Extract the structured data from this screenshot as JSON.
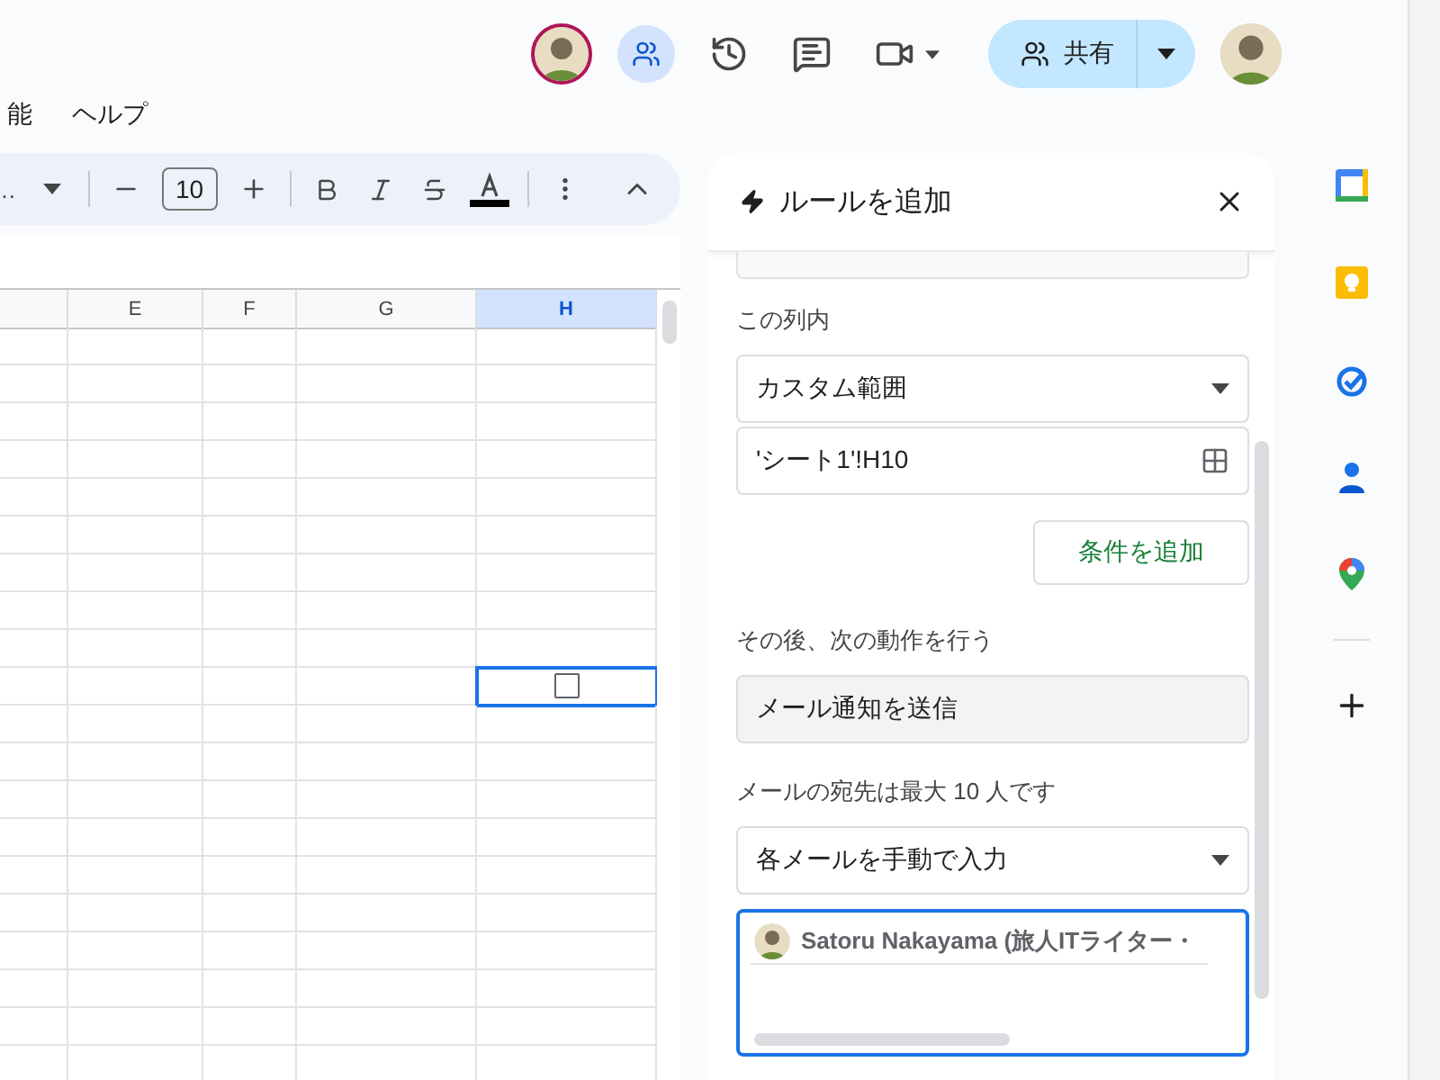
{
  "menu": [
    "能",
    "ヘルプ"
  ],
  "toolbar": {
    "font_name": "…",
    "font_size": "10"
  },
  "share_button": {
    "label": "共有"
  },
  "sheet": {
    "columns": [
      {
        "selected": false
      },
      {
        "label": "E",
        "selected": false
      },
      {
        "label": "F",
        "selected": false
      },
      {
        "label": "G",
        "selected": false
      },
      {
        "label": "H",
        "selected": true
      }
    ],
    "rows": [
      {
        "selected": false
      },
      {
        "selected": false
      },
      {
        "selected": false
      },
      {
        "selected": false
      },
      {
        "selected": false
      },
      {
        "selected": false
      },
      {
        "selected": false
      },
      {
        "selected": false
      },
      {
        "selected": false
      },
      {
        "selected": true,
        "checkbox": {
          "checked": false
        }
      },
      {
        "selected": false
      },
      {
        "selected": false
      },
      {
        "selected": false
      },
      {
        "selected": false
      },
      {
        "selected": false
      },
      {
        "selected": false
      },
      {
        "selected": false
      },
      {
        "selected": false
      },
      {
        "selected": false
      },
      {
        "selected": false
      }
    ]
  },
  "panel": {
    "title": "ルールを追加",
    "range_label": "この列内",
    "range_dropdown": "カスタム範囲",
    "range_field": "'シート1'!H10",
    "add_condition_button": "条件を追加",
    "action_label": "その後、次の動作を行う",
    "action_field": "メール通知を送信",
    "recipients_label": "メールの宛先は最大 10 人です",
    "recipients_dropdown": "各メールを手動で入力",
    "recipients": [
      {
        "name": "Satoru Nakayama (旅人ITライター・"
      }
    ]
  }
}
